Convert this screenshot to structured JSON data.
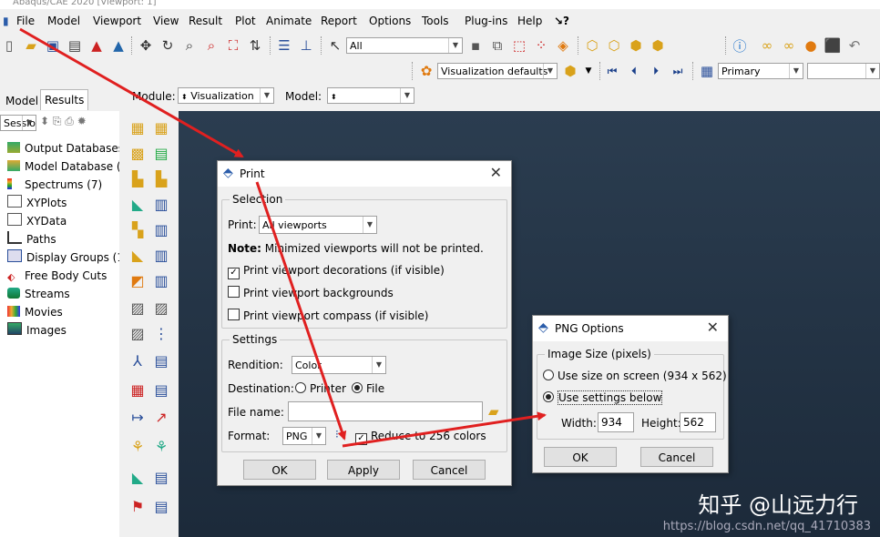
{
  "window": {
    "title": "Abaqus/CAE 2020 [Viewport: 1]"
  },
  "menubar": {
    "items": [
      "File",
      "Model",
      "Viewport",
      "View",
      "Result",
      "Plot",
      "Animate",
      "Report",
      "Options",
      "Tools",
      "Plug-ins",
      "Help",
      "↘?"
    ]
  },
  "toolbar": {
    "selection_filter": "All",
    "visualization_defaults": "Visualization defaults",
    "primary": "Primary"
  },
  "left_panel": {
    "tabs": [
      "Model",
      "Results"
    ],
    "session_combo": "Sessio",
    "tree": [
      "Output Databases",
      "Model Database (",
      "Spectrums (7)",
      "XYPlots",
      "XYData",
      "Paths",
      "Display Groups (1)",
      "Free Body Cuts",
      "Streams",
      "Movies",
      "Images"
    ]
  },
  "context": {
    "module_label": "Module:",
    "module_value": "Visualization",
    "model_label": "Model:"
  },
  "print_dialog": {
    "title": "Print",
    "selection_label": "Selection",
    "print_label": "Print:",
    "print_value": "All viewports",
    "note_bold": "Note:",
    "note_text": "Minimized viewports will not be printed.",
    "opt_decorations": "Print viewport decorations (if visible)",
    "opt_backgrounds": "Print viewport backgrounds",
    "opt_compass": "Print viewport compass (if visible)",
    "settings_label": "Settings",
    "rendition_label": "Rendition:",
    "rendition_value": "Color",
    "destination_label": "Destination:",
    "dest_printer": "Printer",
    "dest_file": "File",
    "filename_label": "File name:",
    "filename_value": "",
    "format_label": "Format:",
    "format_value": "PNG",
    "reduce_label": "Reduce to 256 colors",
    "ok": "OK",
    "apply": "Apply",
    "cancel": "Cancel"
  },
  "png_dialog": {
    "title": "PNG Options",
    "group_label": "Image Size (pixels)",
    "opt_screen": "Use size on screen  (934 x 562)",
    "opt_settings": "Use settings below",
    "width_label": "Width:",
    "width_value": "934",
    "height_label": "Height:",
    "height_value": "562",
    "ok": "OK",
    "cancel": "Cancel"
  },
  "watermark": {
    "main": "知乎 @山远力行",
    "url": "https://blog.csdn.net/qq_41710383"
  },
  "colors": {
    "arrow": "#e02020",
    "viewport_top": "#2b3d50",
    "viewport_bottom": "#1c2a3a"
  }
}
